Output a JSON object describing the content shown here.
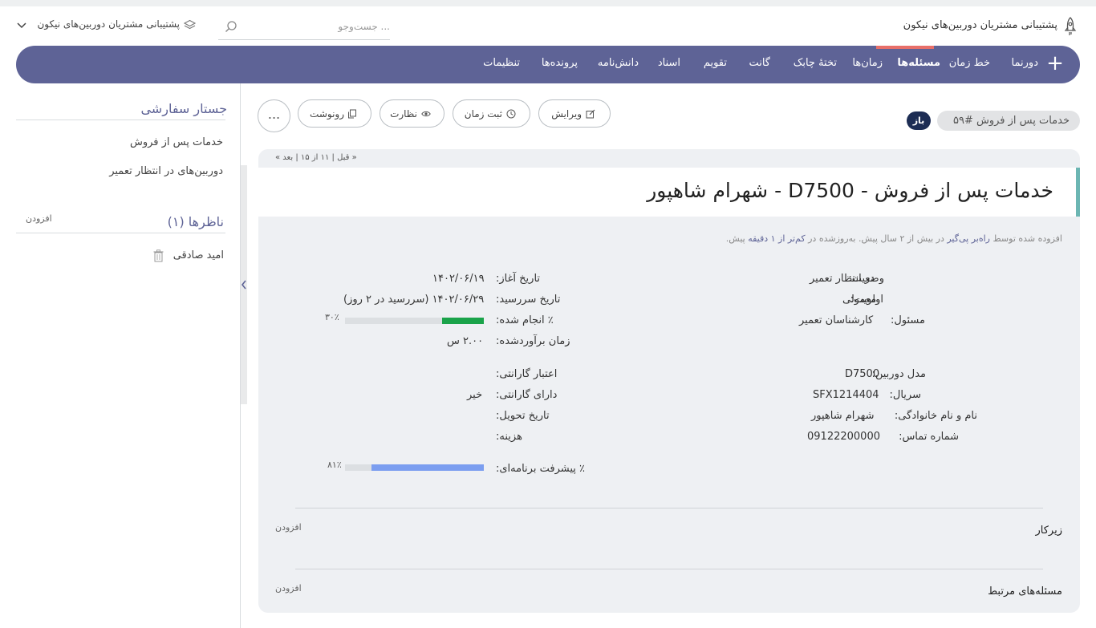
{
  "header": {
    "title": "پشتیبانی مشتریان دوربین‌های نیکون",
    "search_placeholder": "... جست‌وجو",
    "project_selector": "پشتیبانی مشتریان دوربین‌های نیکون"
  },
  "nav": {
    "items": [
      "دورنما",
      "خط زمان",
      "مسئله‌ها",
      "زمان‌ها",
      "تختهٔ چابک",
      "گانت",
      "تقویم",
      "اسناد",
      "دانش‌نامه",
      "پرونده‌ها",
      "تنظیمات"
    ],
    "active": "مسئله‌ها"
  },
  "sidebar": {
    "saved_queries_title": "جستار سفارشی",
    "queries": [
      "خدمات پس از فروش",
      "دوربین‌های در انتظار تعمیر"
    ],
    "watchers_title": "ناظرها (۱)",
    "watchers_add": "افزودن",
    "watchers": [
      "امید صادقی"
    ]
  },
  "issue": {
    "tracker_tag": "خدمات پس از فروش #۵۹",
    "status_badge": "باز",
    "actions": {
      "edit": "ویرایش",
      "log_time": "ثبت زمان",
      "watch": "نظارت",
      "copy": "رونوشت",
      "more": "..."
    },
    "pager": "« قبل | ۱۱ از ۱۵ | بعد »",
    "subject": "خدمات پس از فروش - D7500 - شهرام شاهپور",
    "meta": {
      "added_by": "افزوده شده توسط",
      "author": "راه‌بر پی‌گیر",
      "age_1": "در بیش از ۲ سال",
      "ago_1": "پیش. به‌روزشده در",
      "age_2": "کم‌تر از ۱ دقیقه",
      "ago_2": "پیش."
    },
    "fields_right": [
      {
        "label": "وضعیت:",
        "value": "در انتظار تعمیر"
      },
      {
        "label": "اولویت:",
        "value": "معمولی"
      },
      {
        "label": "مسئول:",
        "value": "کارشناسان تعمیر"
      }
    ],
    "fields_left": {
      "start_label": "تاریخ آغاز:",
      "start_value": "۱۴۰۲/۰۶/۱۹",
      "due_label": "تاریخ سررسید:",
      "due_value": "۱۴۰۲/۰۶/۲۹ (سررسید در ۲ روز)",
      "done_label": "٪ انجام شده:",
      "done_percent": 30,
      "done_text": "۳۰٪",
      "estimate_label": "زمان برآوردشده:",
      "estimate_value": "۲.۰۰ س"
    },
    "custom_right": [
      {
        "label": "مدل دوربین:",
        "value": "D7500"
      },
      {
        "label": "سریال:",
        "value": "SFX1214404"
      },
      {
        "label": "نام و نام خانوادگی:",
        "value": "شهرام شاهپور"
      },
      {
        "label": "شماره تماس:",
        "value": "09122200000"
      }
    ],
    "custom_left": [
      {
        "label": "اعتبار گارانتی:",
        "value": ""
      },
      {
        "label": "دارای گارانتی:",
        "value": "خیر"
      },
      {
        "label": "تاریخ تحویل:",
        "value": ""
      },
      {
        "label": "هزینه:",
        "value": ""
      }
    ],
    "progress": {
      "label": "٪ پیشرفت برنامه‌ای:",
      "percent": 81,
      "text": "۸۱٪"
    },
    "subtasks": {
      "title": "زیرکار",
      "add": "افزودن"
    },
    "relations": {
      "title": "مسئله‌های مرتبط",
      "add": "افزودن"
    }
  },
  "colors": {
    "nav": "#5e6396",
    "accent": "#e8706a",
    "done_bar": "#1aa34a",
    "progress_bar": "#7b9ef0",
    "status_badge": "#1d2d54"
  }
}
